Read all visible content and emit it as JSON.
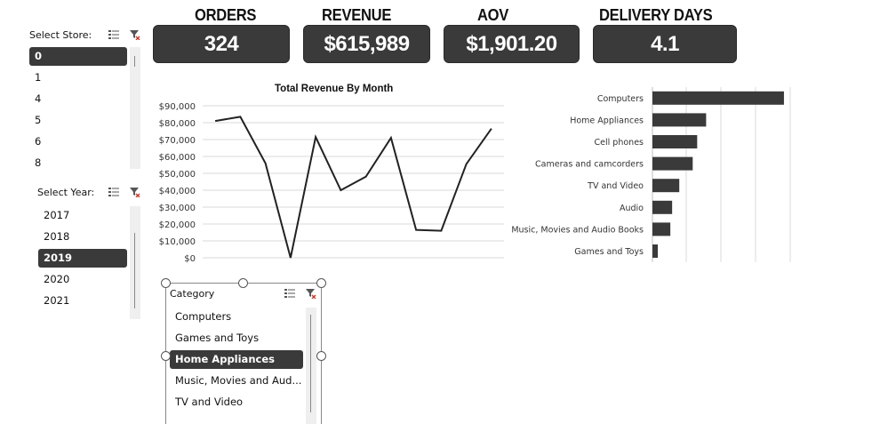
{
  "kpis": [
    {
      "title": "ORDERS",
      "value": "324"
    },
    {
      "title": "REVENUE",
      "value": "$615,989"
    },
    {
      "title": "AOV",
      "value": "$1,901.20"
    },
    {
      "title": "DELIVERY DAYS",
      "value": "4.1"
    }
  ],
  "store_slicer": {
    "label": "Select Store:",
    "items": [
      "0",
      "1",
      "4",
      "5",
      "6",
      "8"
    ],
    "selected": "0"
  },
  "year_slicer": {
    "label": "Select Year:",
    "items": [
      "2017",
      "2018",
      "2019",
      "2020",
      "2021"
    ],
    "selected": "2019"
  },
  "category_slicer": {
    "label": "Category",
    "items": [
      "Computers",
      "Games and Toys",
      "Home Appliances",
      "Music, Movies and Aud...",
      "TV and Video"
    ],
    "selected": "Home Appliances"
  },
  "icons": {
    "multiselect": "multi-select-icon",
    "clear_filter": "clear-filter-icon"
  },
  "colors": {
    "dark": "#3a3a3a",
    "line": "#222222",
    "bar": "#3a3a3a",
    "clear_icon_accent": "#c0392b"
  },
  "chart_data": [
    {
      "type": "line",
      "title": "Total Revenue By Month",
      "y_ticks": [
        "$0",
        "$10,000",
        "$20,000",
        "$30,000",
        "$40,000",
        "$50,000",
        "$60,000",
        "$70,000",
        "$80,000",
        "$90,000"
      ],
      "ylim": [
        0,
        90000
      ],
      "series": [
        {
          "values": [
            81000,
            83500,
            56000,
            0,
            71500,
            40000,
            48000,
            71000,
            16500,
            16000,
            55500,
            76500
          ]
        }
      ],
      "grid": true
    },
    {
      "type": "bar",
      "orientation": "horizontal",
      "categories": [
        "Computers",
        "Home Appliances",
        "Cell phones",
        "Cameras and camcorders",
        "TV and Video",
        "Audio",
        "Music, Movies and Audio Books",
        "Games and Toys"
      ],
      "values": [
        147,
        60,
        50,
        45,
        30,
        22,
        20,
        6
      ],
      "xlim": [
        0,
        155
      ],
      "grid": true
    }
  ]
}
